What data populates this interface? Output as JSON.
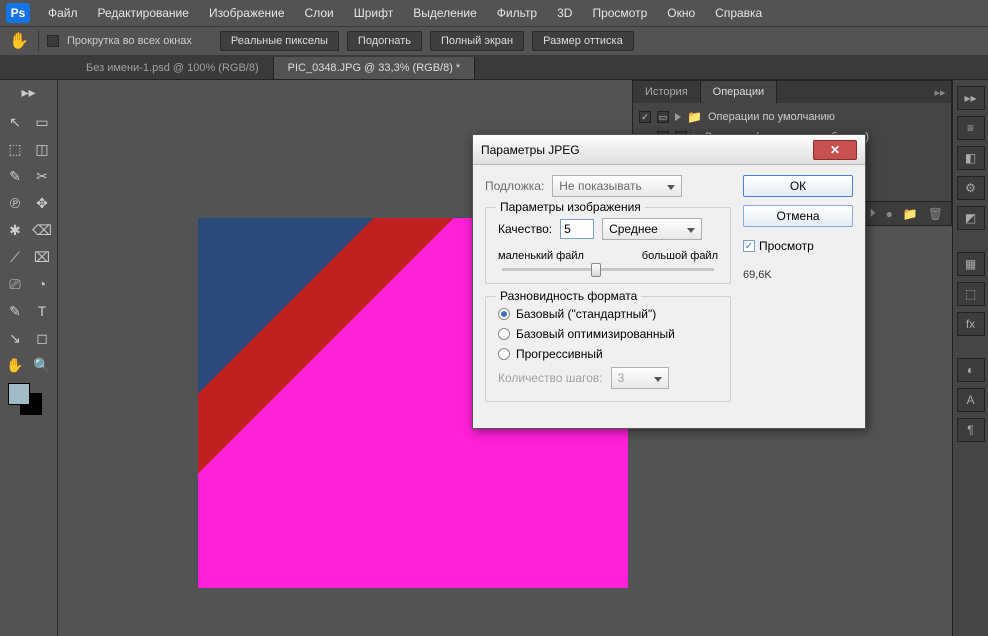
{
  "app": {
    "logo": "Ps"
  },
  "menu": [
    "Файл",
    "Редактирование",
    "Изображение",
    "Слои",
    "Шрифт",
    "Выделение",
    "Фильтр",
    "3D",
    "Просмотр",
    "Окно",
    "Справка"
  ],
  "options": {
    "scroll_all": "Прокрутка во всех окнах",
    "buttons": [
      "Реальные пикселы",
      "Подогнать",
      "Полный экран",
      "Размер оттиска"
    ]
  },
  "tabs": [
    {
      "label": "Без имени-1.psd @ 100% (RGB/8)",
      "active": false
    },
    {
      "label": "PIC_0348.JPG @ 33,3% (RGB/8) *",
      "active": true
    }
  ],
  "right_panel": {
    "tabs": [
      "История",
      "Операции"
    ],
    "active_tab": 1,
    "rows": [
      {
        "label": "Операции по умолчанию",
        "folder": true,
        "indent": 0
      },
      {
        "label": "Виньетка (выделенная область)",
        "folder": false,
        "indent": 1
      }
    ],
    "footer_icons": [
      "■",
      "⏵",
      "●",
      "📁",
      "🗑"
    ]
  },
  "dialog": {
    "title": "Параметры JPEG",
    "matte_label": "Подложка:",
    "matte_value": "Не показывать",
    "image_group": "Параметры изображения",
    "quality_label": "Качество:",
    "quality_value": "5",
    "quality_preset": "Среднее",
    "slider_small": "маленький файл",
    "slider_big": "большой файл",
    "slider_pos_percent": 42,
    "format_group": "Разновидность формата",
    "format_options": [
      {
        "label": "Базовый (\"стандартный\")",
        "selected": true
      },
      {
        "label": "Базовый оптимизированный",
        "selected": false
      },
      {
        "label": "Прогрессивный",
        "selected": false
      }
    ],
    "scans_label": "Количество шагов:",
    "scans_value": "3",
    "ok": "ОК",
    "cancel": "Отмена",
    "preview": "Просмотр",
    "filesize": "69,6K"
  },
  "tools_left": [
    "▭",
    "↖",
    "⬚",
    "◫",
    "✎",
    "✂",
    "℗",
    "✥",
    "✱",
    "⌫",
    "⟋",
    "⌧",
    "⎚",
    "◔",
    "✎",
    "T",
    "↘",
    "◻",
    "✋",
    "🔍"
  ],
  "right_dock": [
    "▸",
    "≡",
    "◧",
    "⚙",
    "◩",
    "▦",
    "⬚",
    "fx",
    "◐",
    "A",
    "¶"
  ]
}
